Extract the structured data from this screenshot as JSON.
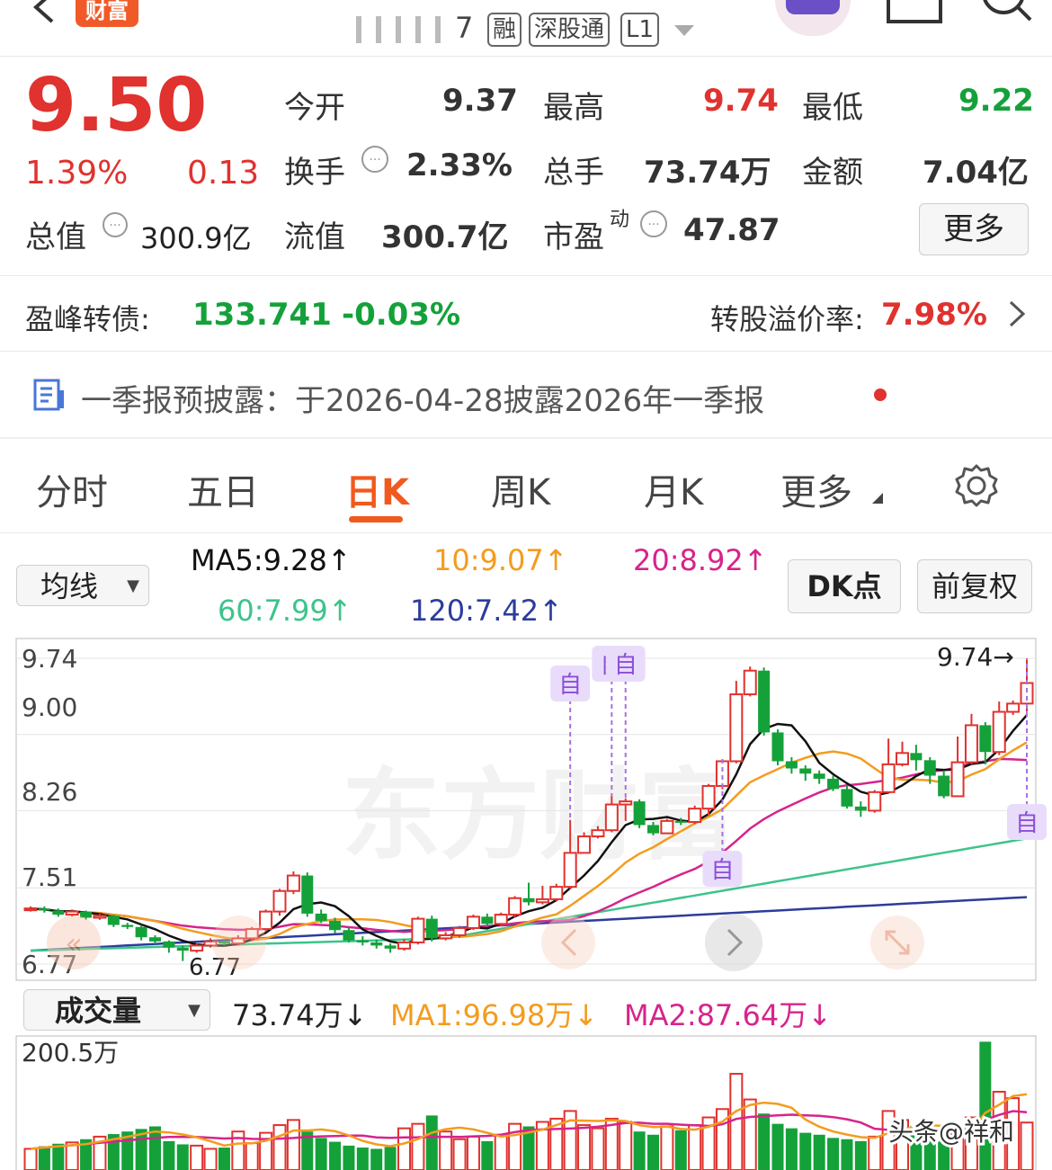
{
  "header": {
    "back_icon": "chevron-left-icon",
    "brand_badge": "财富",
    "stock_code": "7",
    "tags": [
      "融",
      "深股通",
      "L1"
    ],
    "dropdown_icon": "caret-down-icon",
    "avatar_icon": "avatar-icon",
    "window_icon": "window-icon",
    "search_icon": "search-icon"
  },
  "quote": {
    "price": "9.50",
    "change_pct": "1.39%",
    "change_amt": "0.13",
    "open_label": "今开",
    "open": "9.37",
    "high_label": "最高",
    "high": "9.74",
    "low_label": "最低",
    "low": "9.22",
    "turnover_label": "换手",
    "turnover": "2.33%",
    "volume_label": "总手",
    "volume": "73.74万",
    "amount_label": "金额",
    "amount": "7.04亿",
    "mktcap_label": "总值",
    "mktcap": "300.9亿",
    "float_label": "流值",
    "float": "300.7亿",
    "pe_label": "市盈",
    "pe_sup": "动",
    "pe": "47.87",
    "more_button": "更多",
    "colors": {
      "up": "#e0322e",
      "down": "#14a13a"
    }
  },
  "bond": {
    "label": "盈峰转债:",
    "price": "133.741",
    "change": "-0.03%",
    "premium_label": "转股溢价率:",
    "premium": "7.98%"
  },
  "notice": {
    "text": "一季报预披露：于2026-04-28披露2026年一季报"
  },
  "tabs": {
    "items": [
      "分时",
      "五日",
      "日K",
      "周K",
      "月K",
      "更多"
    ],
    "active": "日K",
    "settings_icon": "gear-icon",
    "accent": "#f05a1e"
  },
  "ma_panel": {
    "select_label": "均线",
    "ma5": "MA5:9.28↑",
    "ma10": "10:9.07↑",
    "ma20": "20:8.92↑",
    "ma60": "60:7.99↑",
    "ma120": "120:7.42↑",
    "dk_button": "DK点",
    "adjust_button": "前复权",
    "colors": {
      "ma5": "#111111",
      "ma10": "#f39c1f",
      "ma20": "#d6248c",
      "ma60": "#3cc48c",
      "ma120": "#2c3c9c"
    }
  },
  "kline": {
    "y_labels": [
      "9.74",
      "9.00",
      "8.26",
      "7.51",
      "6.77"
    ],
    "high_marker": "9.74→",
    "low_marker": "6.77",
    "marker_glyph": "自",
    "watermark": "东方财富"
  },
  "volume_panel": {
    "select_label": "成交量",
    "vol": "73.74万↓",
    "ma1": "MA1:96.98万↓",
    "ma2": "MA2:87.64万↓",
    "y_label": "200.5万",
    "credit": "头条@祥和"
  },
  "chart_data": {
    "type": "candlestick",
    "ylim": [
      6.77,
      9.74
    ],
    "candles": [
      [
        7.3,
        7.31,
        7.33,
        7.28
      ],
      [
        7.31,
        7.29,
        7.33,
        7.27
      ],
      [
        7.29,
        7.25,
        7.31,
        7.23
      ],
      [
        7.25,
        7.28,
        7.3,
        7.23
      ],
      [
        7.28,
        7.22,
        7.29,
        7.2
      ],
      [
        7.22,
        7.24,
        7.26,
        7.2
      ],
      [
        7.24,
        7.15,
        7.25,
        7.13
      ],
      [
        7.15,
        7.13,
        7.17,
        7.11
      ],
      [
        7.13,
        7.03,
        7.15,
        7.0
      ],
      [
        7.03,
        6.99,
        7.05,
        6.96
      ],
      [
        6.99,
        6.93,
        7.0,
        6.88
      ],
      [
        6.93,
        6.9,
        6.95,
        6.8
      ],
      [
        6.9,
        6.95,
        6.97,
        6.88
      ],
      [
        6.95,
        6.99,
        7.02,
        6.93
      ],
      [
        6.99,
        6.97,
        7.0,
        6.95
      ],
      [
        6.97,
        7.02,
        7.05,
        6.95
      ],
      [
        7.02,
        7.11,
        7.13,
        7.0
      ],
      [
        7.11,
        7.28,
        7.3,
        7.08
      ],
      [
        7.28,
        7.48,
        7.5,
        7.24
      ],
      [
        7.48,
        7.63,
        7.67,
        7.45
      ],
      [
        7.63,
        7.26,
        7.66,
        7.23
      ],
      [
        7.26,
        7.19,
        7.3,
        7.17
      ],
      [
        7.19,
        7.1,
        7.22,
        7.07
      ],
      [
        7.1,
        7.0,
        7.12,
        6.98
      ],
      [
        7.0,
        6.98,
        7.04,
        6.95
      ],
      [
        6.98,
        6.95,
        7.01,
        6.92
      ],
      [
        6.95,
        6.92,
        6.97,
        6.88
      ],
      [
        6.92,
        6.98,
        7.01,
        6.9
      ],
      [
        6.98,
        7.21,
        7.23,
        6.96
      ],
      [
        7.21,
        7.02,
        7.24,
        6.99
      ],
      [
        7.02,
        7.05,
        7.08,
        7.0
      ],
      [
        7.05,
        7.12,
        7.14,
        7.03
      ],
      [
        7.12,
        7.23,
        7.25,
        7.1
      ],
      [
        7.23,
        7.16,
        7.26,
        7.14
      ],
      [
        7.16,
        7.25,
        7.27,
        7.14
      ],
      [
        7.25,
        7.41,
        7.43,
        7.22
      ],
      [
        7.41,
        7.37,
        7.56,
        7.34
      ],
      [
        7.37,
        7.4,
        7.53,
        7.35
      ],
      [
        7.4,
        7.52,
        7.55,
        7.38
      ],
      [
        7.52,
        7.85,
        8.17,
        7.5
      ],
      [
        7.85,
        8.01,
        8.05,
        7.98
      ],
      [
        8.01,
        8.07,
        8.11,
        7.99
      ],
      [
        8.07,
        8.32,
        8.4,
        8.05
      ],
      [
        8.32,
        8.35,
        8.38,
        8.16
      ],
      [
        8.35,
        8.12,
        8.37,
        8.09
      ],
      [
        8.12,
        8.04,
        8.15,
        8.02
      ],
      [
        8.04,
        8.16,
        8.18,
        8.05
      ],
      [
        8.16,
        8.15,
        8.19,
        8.12
      ],
      [
        8.15,
        8.28,
        8.31,
        8.13
      ],
      [
        8.28,
        8.5,
        8.52,
        8.21
      ],
      [
        8.5,
        8.74,
        8.76,
        8.47
      ],
      [
        8.74,
        9.39,
        9.52,
        8.72
      ],
      [
        9.39,
        9.62,
        9.66,
        9.37
      ],
      [
        9.62,
        9.02,
        9.65,
        8.99
      ],
      [
        9.02,
        8.74,
        9.05,
        8.7
      ],
      [
        8.74,
        8.67,
        8.78,
        8.62
      ],
      [
        8.67,
        8.62,
        8.7,
        8.55
      ],
      [
        8.62,
        8.57,
        8.65,
        8.52
      ],
      [
        8.57,
        8.47,
        8.6,
        8.45
      ],
      [
        8.47,
        8.3,
        8.5,
        8.28
      ],
      [
        8.3,
        8.26,
        8.35,
        8.2
      ],
      [
        8.26,
        8.44,
        8.46,
        8.24
      ],
      [
        8.44,
        8.71,
        8.96,
        8.7
      ],
      [
        8.71,
        8.82,
        8.93,
        8.69
      ],
      [
        8.82,
        8.75,
        8.9,
        8.65
      ],
      [
        8.75,
        8.6,
        8.78,
        8.52
      ],
      [
        8.6,
        8.4,
        8.65,
        8.38
      ],
      [
        8.4,
        8.73,
        8.98,
        8.67
      ],
      [
        8.73,
        9.09,
        9.2,
        8.71
      ],
      [
        9.09,
        8.83,
        9.12,
        8.71
      ],
      [
        8.83,
        9.22,
        9.32,
        8.8
      ],
      [
        9.22,
        9.3,
        9.33,
        9.19
      ],
      [
        9.3,
        9.5,
        9.74,
        9.22
      ]
    ],
    "annotations": [
      {
        "glyph": "自",
        "x_index": 39
      },
      {
        "glyph": "自",
        "x_index": 42
      },
      {
        "glyph": "自",
        "x_index": 43
      },
      {
        "glyph": "自",
        "x_index": 50
      },
      {
        "glyph": "自",
        "x_index": 72
      }
    ],
    "volume": {
      "ylim": [
        0,
        200.5
      ],
      "values": [
        33,
        37,
        41,
        43,
        48,
        52,
        56,
        60,
        64,
        68,
        45,
        40,
        38,
        33,
        35,
        60,
        42,
        58,
        70,
        78,
        60,
        50,
        44,
        38,
        35,
        33,
        36,
        65,
        72,
        85,
        60,
        48,
        52,
        45,
        55,
        72,
        68,
        75,
        80,
        92,
        70,
        65,
        80,
        75,
        60,
        55,
        68,
        62,
        70,
        82,
        95,
        150,
        110,
        88,
        72,
        65,
        58,
        55,
        50,
        48,
        45,
        52,
        92,
        78,
        70,
        58,
        45,
        60,
        82,
        200,
        122,
        112,
        74
      ]
    }
  }
}
